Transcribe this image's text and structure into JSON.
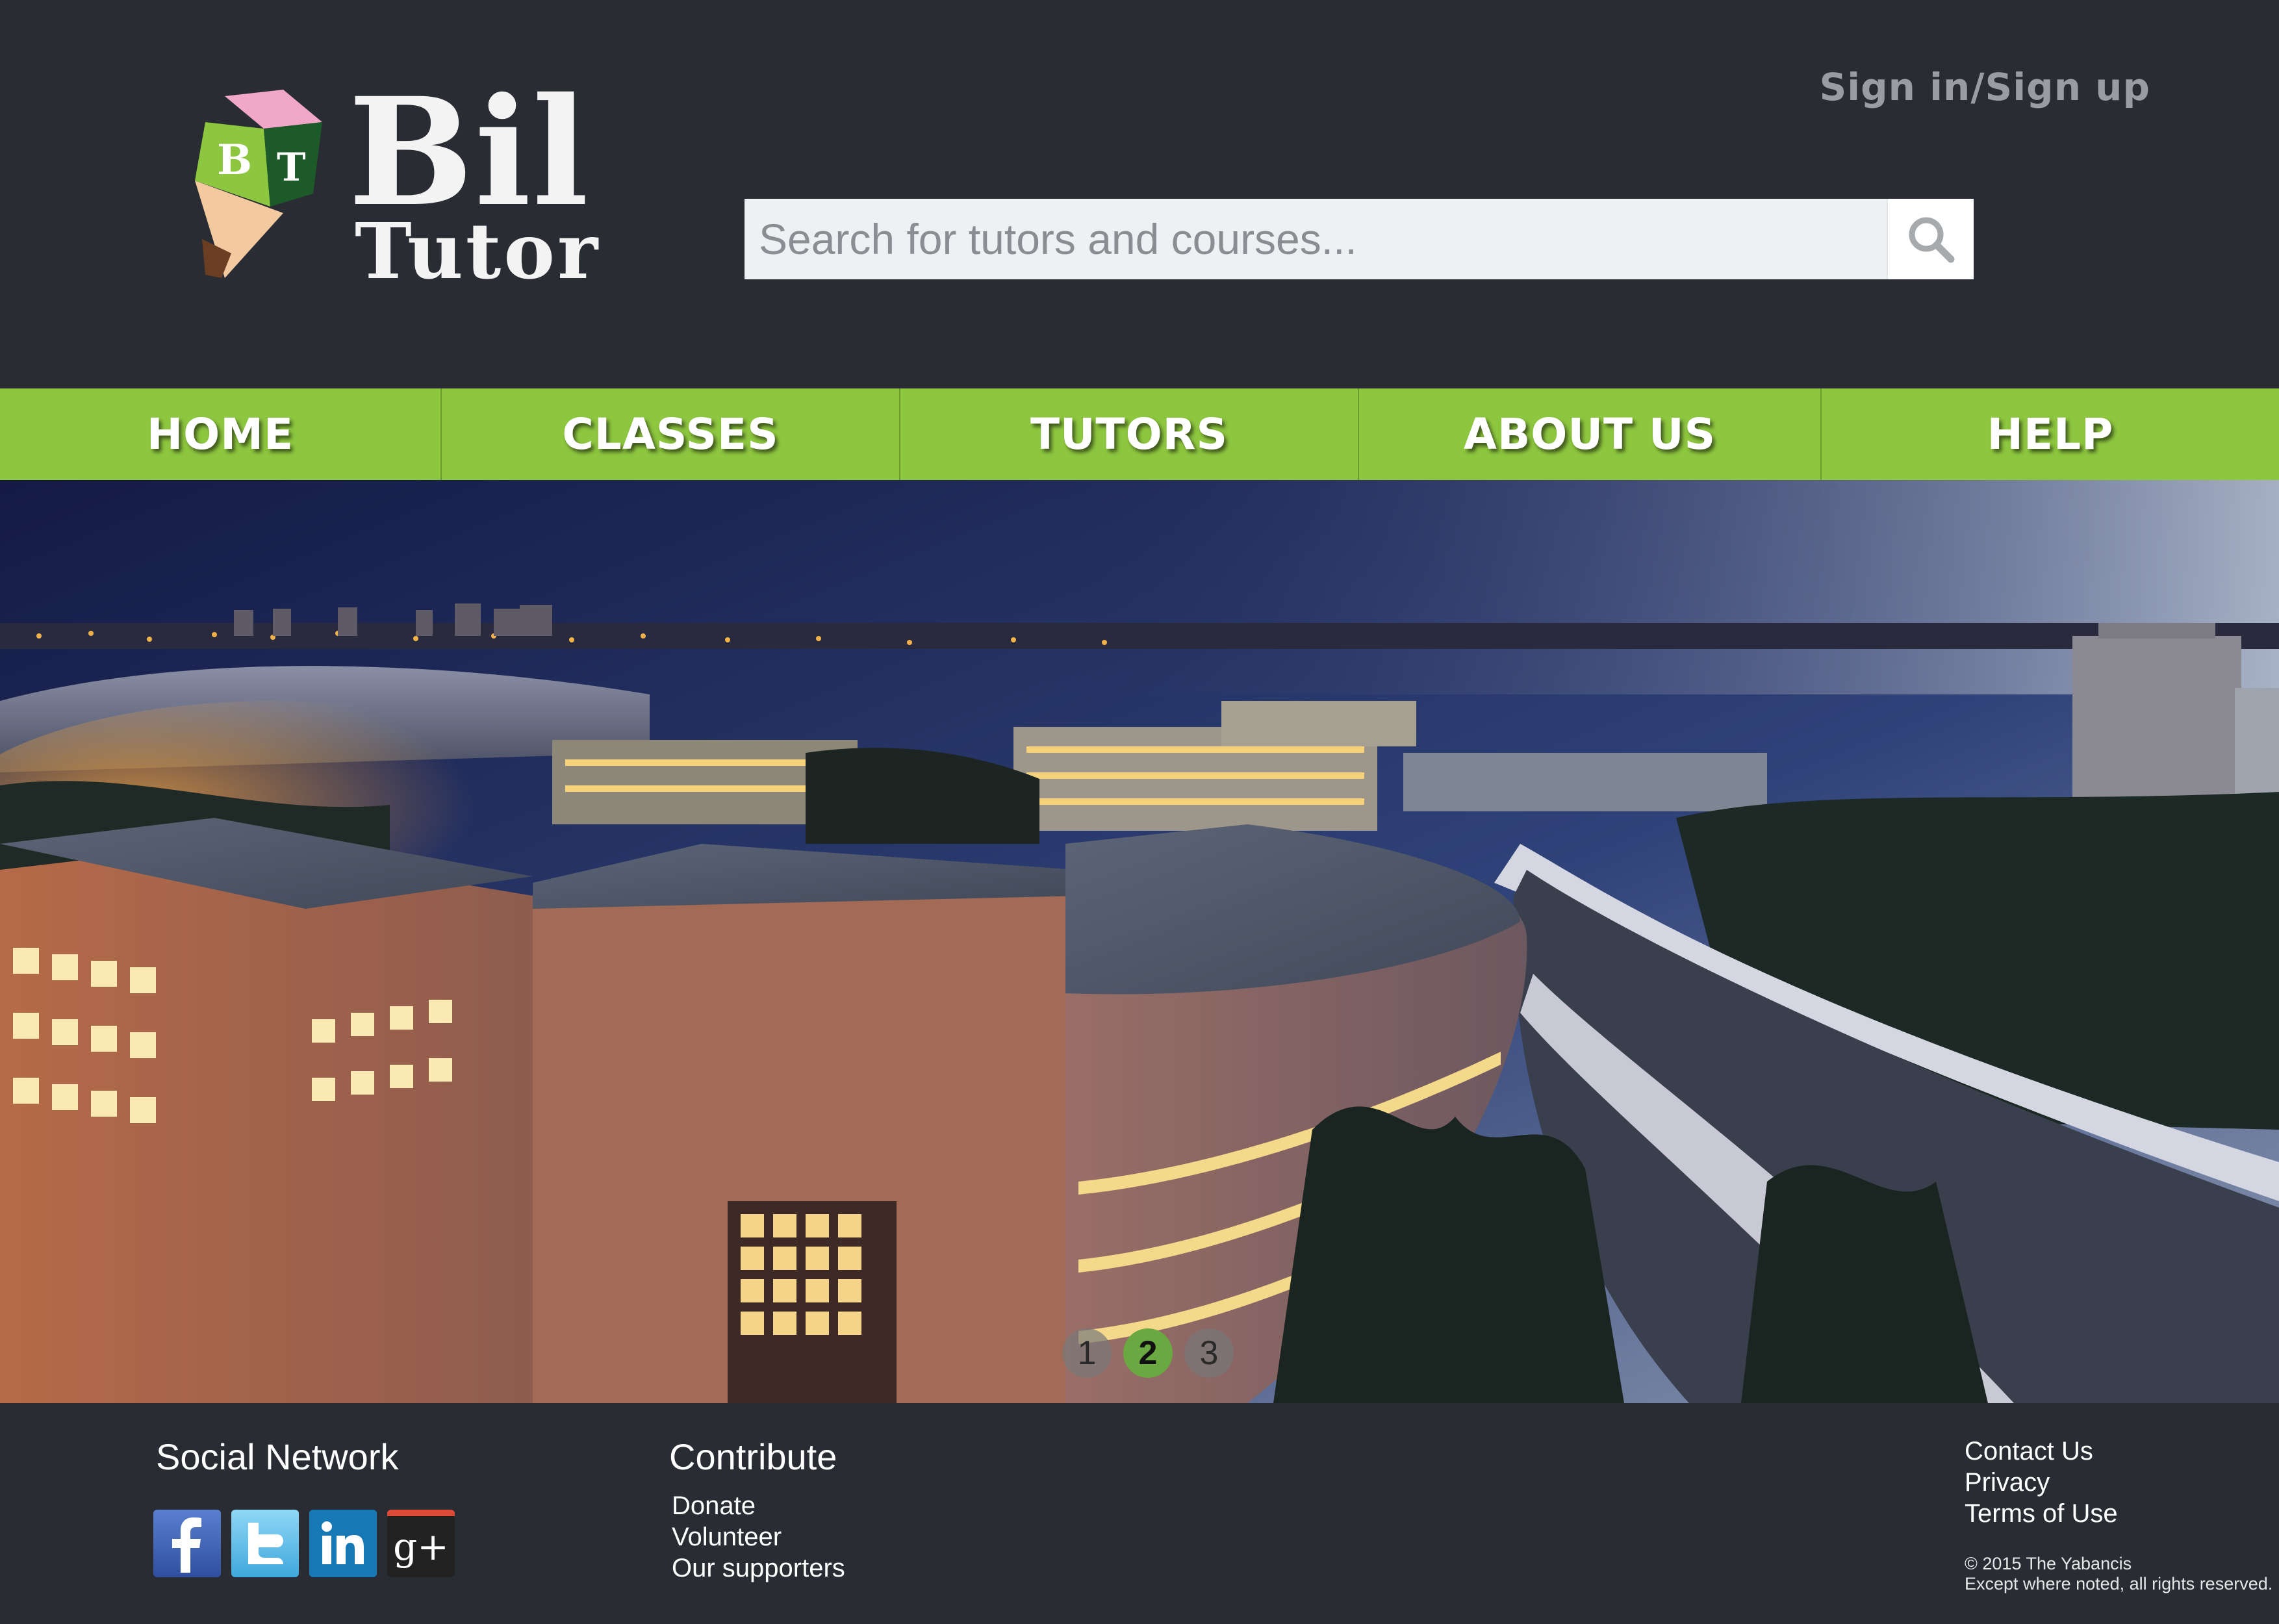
{
  "header": {
    "logo": {
      "badge_letters": [
        "B",
        "T"
      ],
      "word_line_1": "Bil",
      "word_line_2": "Tutor"
    },
    "signin_label": "Sign in/Sign up",
    "search": {
      "placeholder": "Search for tutors and courses...",
      "value": "",
      "button_icon": "search-icon"
    }
  },
  "nav": {
    "items": [
      {
        "label": "HOME"
      },
      {
        "label": "CLASSES"
      },
      {
        "label": "TUTORS"
      },
      {
        "label": "ABOUT US"
      },
      {
        "label": "HELP"
      }
    ]
  },
  "hero": {
    "image": "campus-night-panorama",
    "slides": [
      "1",
      "2",
      "3"
    ],
    "active_slide": 2
  },
  "footer": {
    "social": {
      "heading": "Social Network",
      "icons": [
        "facebook-icon",
        "twitter-icon",
        "linkedin-icon",
        "google-plus-icon"
      ],
      "gplus_text": "g+"
    },
    "contribute": {
      "heading": "Contribute",
      "links": [
        "Donate",
        "Volunteer",
        "Our supporters"
      ]
    },
    "legal": {
      "links": [
        "Contact Us",
        "Privacy",
        "Terms of Use"
      ],
      "copyright_line_1": "© 2015 The Yabancis",
      "copyright_line_2": "Except where noted, all rights reserved."
    }
  },
  "colors": {
    "background": "#2a2c34",
    "nav_green": "#8dc63f",
    "active_dot": "#6aa842",
    "signin_gray": "#9a9ca2"
  }
}
